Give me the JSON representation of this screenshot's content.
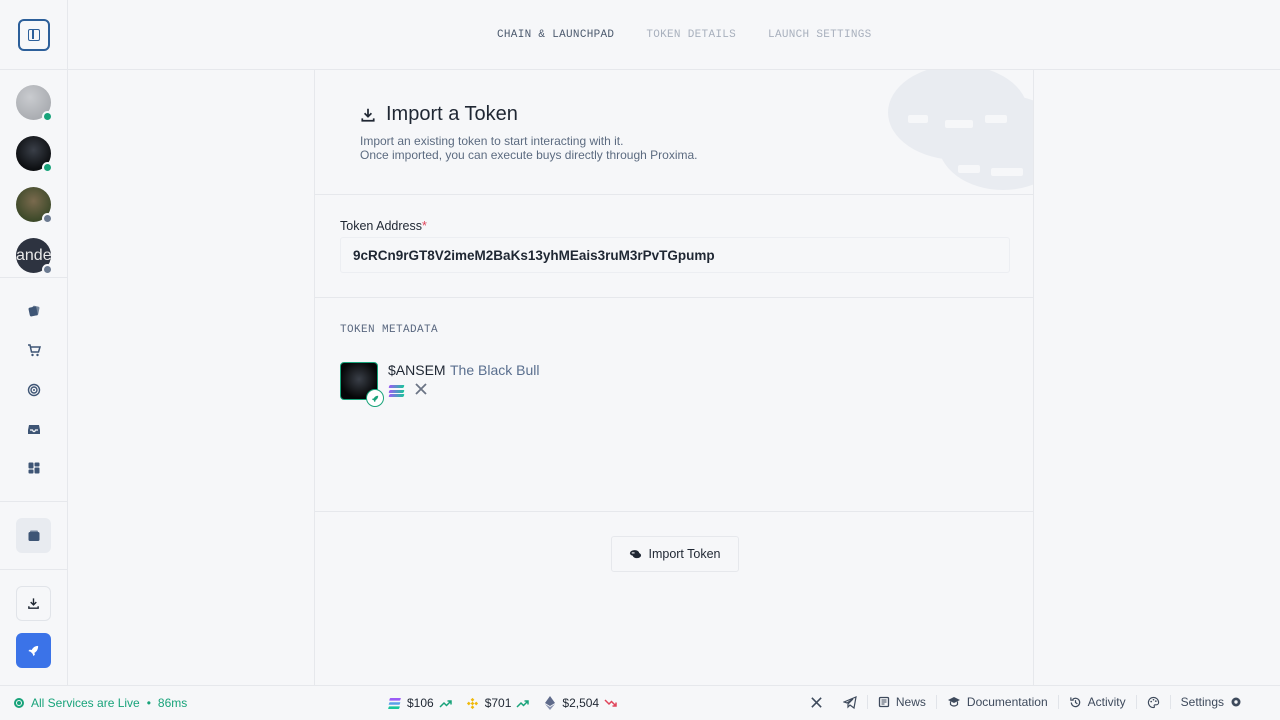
{
  "tabs": [
    {
      "label": "CHAIN & LAUNCHPAD",
      "active": true
    },
    {
      "label": "TOKEN DETAILS",
      "active": false
    },
    {
      "label": "LAUNCH SETTINGS",
      "active": false
    }
  ],
  "sidebar": {
    "avatars": [
      {
        "status": "online"
      },
      {
        "status": "online"
      },
      {
        "status": "offline"
      },
      {
        "text": "ande",
        "status": "offline"
      }
    ],
    "nav_icons": [
      "cards-icon",
      "cart-icon",
      "radar-icon",
      "inbox-icon",
      "dashboard-icon"
    ]
  },
  "import": {
    "title": "Import a Token",
    "subtitle_line1": "Import an existing token to start interacting with it.",
    "subtitle_line2": "Once imported, you can execute buys directly through Proxima."
  },
  "form": {
    "address_label": "Token Address",
    "required_mark": "*",
    "address_value": "9cRCn9rGT8V2imeM2BaKs13yhMEais3ruM3rPvTGpump"
  },
  "metadata": {
    "section_title": "TOKEN METADATA",
    "symbol": "$ANSEM",
    "name": "The Black Bull"
  },
  "import_button": "Import Token",
  "footer": {
    "status": "All Services are Live",
    "bullet": "•",
    "latency": "86ms",
    "prices": [
      {
        "icon": "solana-icon",
        "value": "$106",
        "trend": "up"
      },
      {
        "icon": "bnb-icon",
        "value": "$701",
        "trend": "up"
      },
      {
        "icon": "ethereum-icon",
        "value": "$2,504",
        "trend": "down"
      }
    ],
    "links": {
      "news": "News",
      "docs": "Documentation",
      "activity": "Activity",
      "settings": "Settings"
    }
  }
}
